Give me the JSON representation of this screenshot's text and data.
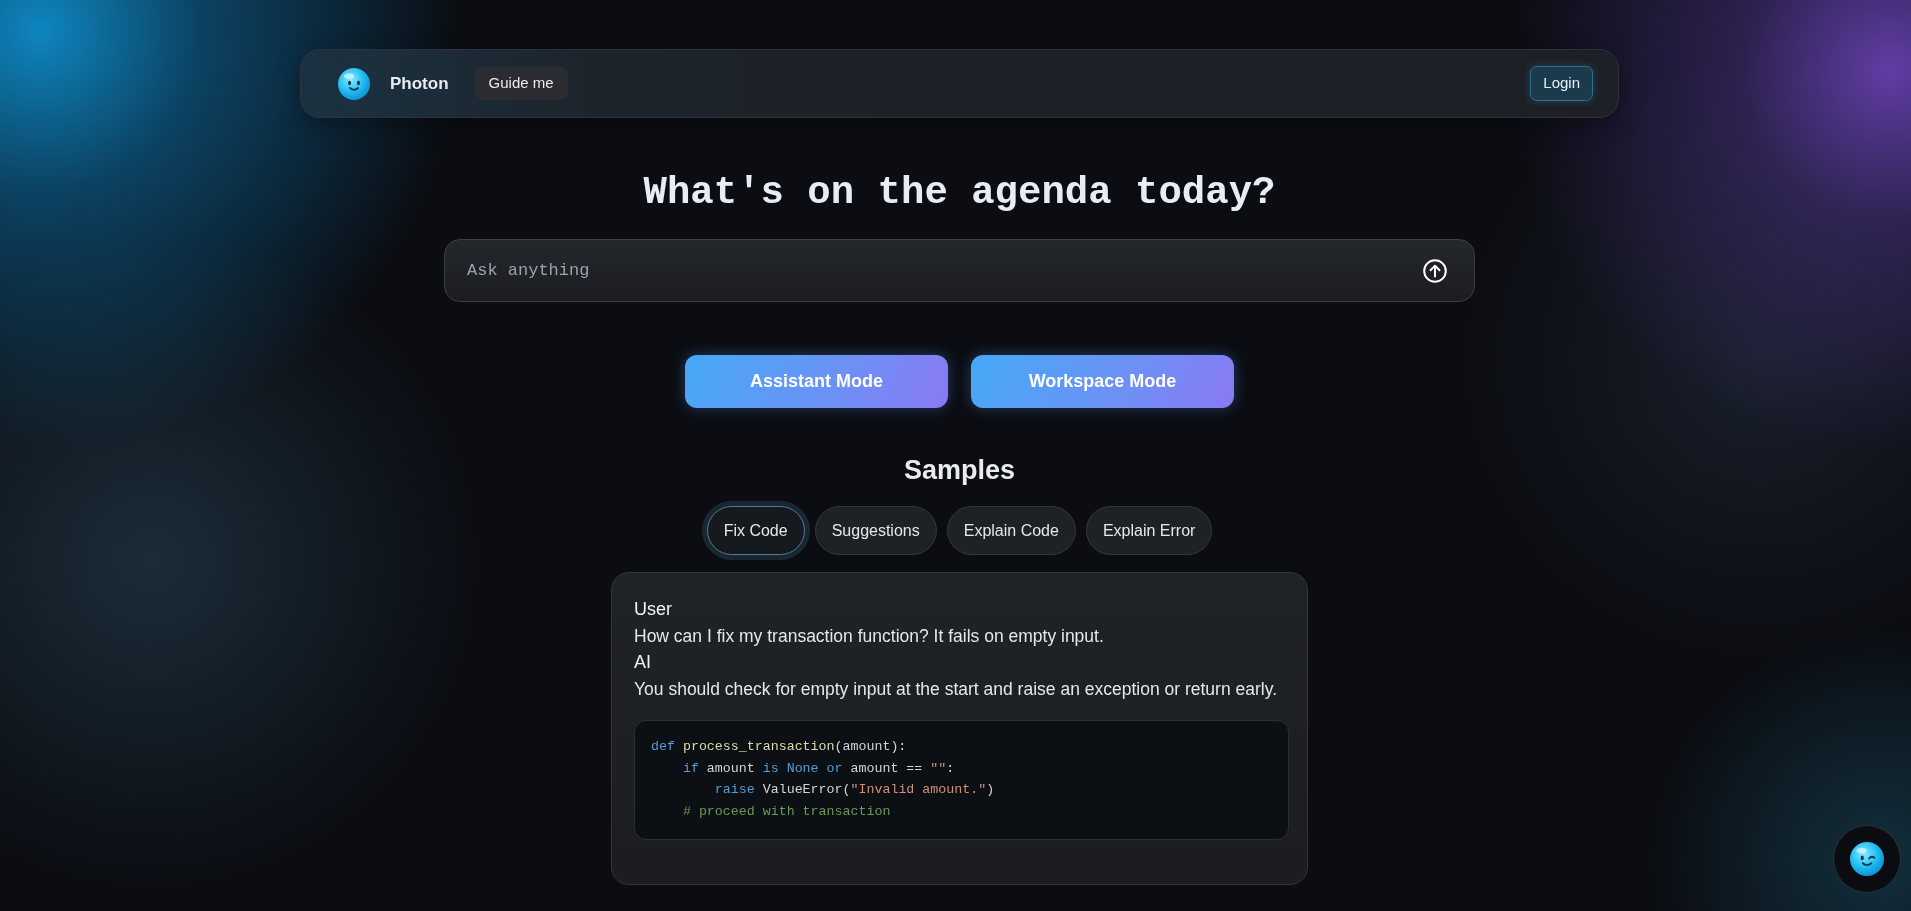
{
  "navbar": {
    "brand": "Photon",
    "guide_button": "Guide me",
    "login_button": "Login"
  },
  "heading": "What's on the agenda today?",
  "search": {
    "placeholder": "Ask anything"
  },
  "modes": [
    "Assistant Mode",
    "Workspace Mode"
  ],
  "samples": {
    "title": "Samples",
    "tabs": [
      {
        "label": "Fix Code",
        "selected": true
      },
      {
        "label": "Suggestions",
        "selected": false
      },
      {
        "label": "Explain Code",
        "selected": false
      },
      {
        "label": "Explain Error",
        "selected": false
      }
    ],
    "conversation": [
      {
        "speaker": "User",
        "message": "How can I fix my transaction function? It fails on empty input."
      },
      {
        "speaker": "AI",
        "message": "You should check for empty input at the start and raise an exception or return early."
      }
    ],
    "code_lines": [
      [
        {
          "text": "def ",
          "kind": "keyword"
        },
        {
          "text": "process_transaction",
          "kind": "function"
        },
        {
          "text": "(amount):",
          "kind": "plain"
        }
      ],
      [
        {
          "text": "    if ",
          "kind": "keyword"
        },
        {
          "text": "amount ",
          "kind": "plain"
        },
        {
          "text": "is None or ",
          "kind": "keyword"
        },
        {
          "text": "amount == ",
          "kind": "plain"
        },
        {
          "text": "\"\"",
          "kind": "string"
        },
        {
          "text": ":",
          "kind": "plain"
        }
      ],
      [
        {
          "text": "        raise ",
          "kind": "keyword"
        },
        {
          "text": "ValueError(",
          "kind": "plain"
        },
        {
          "text": "\"Invalid amount.\"",
          "kind": "string"
        },
        {
          "text": ")",
          "kind": "plain"
        }
      ],
      [
        {
          "text": "    # proceed with transaction",
          "kind": "comment"
        }
      ]
    ]
  }
}
